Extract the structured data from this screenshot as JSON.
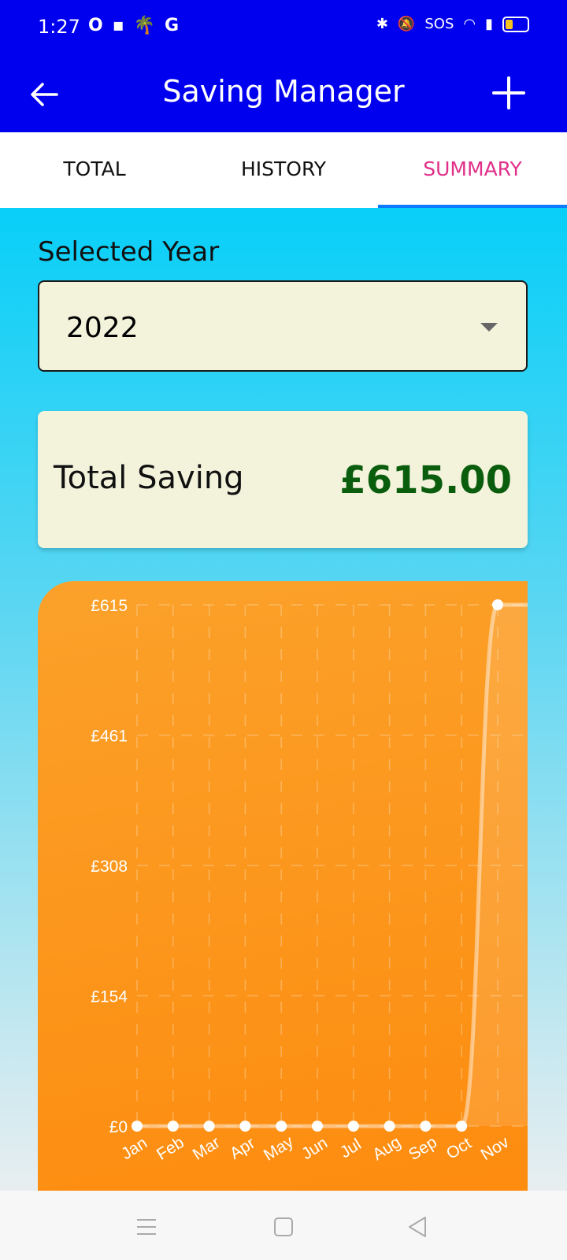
{
  "status_bar": {
    "time": "1:27",
    "sos": "SOS",
    "battery_level_percent": 20
  },
  "app_bar": {
    "title": "Saving Manager",
    "back_icon": "arrow-left-icon",
    "add_icon": "plus-icon"
  },
  "tabs": [
    {
      "label": "TOTAL"
    },
    {
      "label": "HISTORY"
    },
    {
      "label": "SUMMARY"
    }
  ],
  "active_tab": "SUMMARY",
  "year_selector": {
    "label": "Selected Year",
    "value": "2022"
  },
  "total": {
    "label": "Total Saving",
    "value": "£615.00"
  },
  "colors": {
    "app_bar": "#0000ef",
    "active_tab_text": "#e0308a",
    "tab_indicator": "#0b7cff",
    "total_value": "#0b5d0e",
    "chart_fill": "#fd8c0f"
  },
  "chart_data": {
    "type": "line",
    "x": [
      "Jan",
      "Feb",
      "Mar",
      "Apr",
      "May",
      "Jun",
      "Jul",
      "Aug",
      "Sep",
      "Oct",
      "Nov"
    ],
    "series": [
      {
        "values": [
          0,
          0,
          0,
          0,
          0,
          0,
          0,
          0,
          0,
          0,
          615
        ]
      }
    ],
    "y_ticks": [
      "£615",
      "£461",
      "£308",
      "£154",
      "£0"
    ],
    "ylim": [
      0,
      615
    ],
    "grid": true
  },
  "nav_bar": {
    "icons": [
      "menu-icon",
      "home-square-icon",
      "back-triangle-icon"
    ]
  }
}
